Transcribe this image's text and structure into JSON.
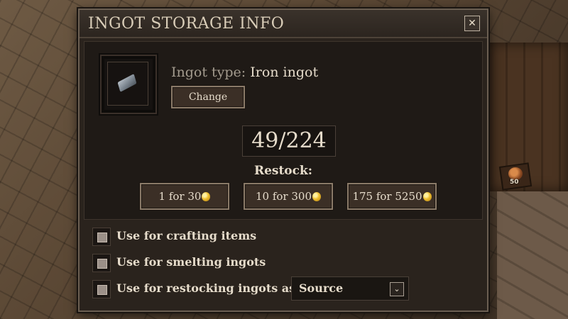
{
  "window": {
    "title": "INGOT STORAGE INFO",
    "close_icon": "close-icon",
    "close_glyph": "✕"
  },
  "ingot": {
    "type_label": "Ingot type:",
    "type_value": "Iron ingot",
    "icon": "iron-ingot-icon",
    "change_label": "Change"
  },
  "storage": {
    "count": "49/224"
  },
  "restock": {
    "label": "Restock:",
    "options": [
      {
        "label": "1 for 30",
        "icon": "gold-coin-icon"
      },
      {
        "label": "10 for 300",
        "icon": "gold-coin-icon"
      },
      {
        "label": "175 for 5250",
        "icon": "gold-coin-icon"
      }
    ]
  },
  "options": {
    "crafting": {
      "label": "Use for crafting items",
      "checked": false
    },
    "smelting": {
      "label": "Use for smelting ingots",
      "checked": false
    },
    "restocking": {
      "label": "Use for restocking ingots as:",
      "checked": false
    }
  },
  "restock_mode": {
    "selected": "Source",
    "arrow_icon": "chevron-down-icon",
    "arrow_glyph": "⌄"
  },
  "scene": {
    "stack_count": "50"
  },
  "colors": {
    "panel_bg": "#2a231d",
    "text": "#e6dccb",
    "coin": "#f0c030"
  }
}
